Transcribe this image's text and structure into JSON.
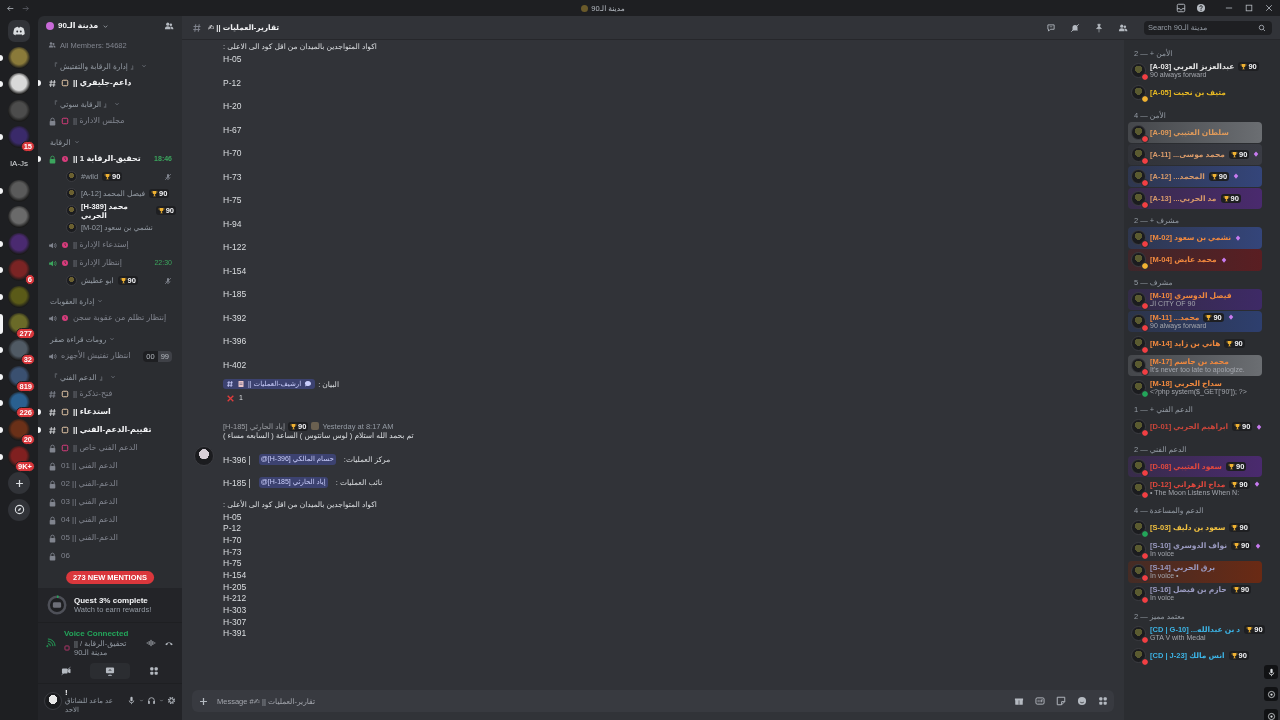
{
  "titlebar": {
    "title": "مدينة الـ90"
  },
  "servers": [
    {
      "kind": "home",
      "unread": false,
      "selected": false
    },
    {
      "kind": "server",
      "unread": true,
      "selected": false,
      "color": "#8a7a3a"
    },
    {
      "kind": "server",
      "unread": true,
      "selected": false,
      "color": "#d9d9d9"
    },
    {
      "kind": "server",
      "unread": false,
      "selected": false,
      "color": "#4c4c4c"
    },
    {
      "kind": "server",
      "unread": true,
      "selected": false,
      "color": "#3a2a6a",
      "badge": "15"
    },
    {
      "kind": "label",
      "unread": false,
      "selected": false,
      "text": "IA-Js"
    },
    {
      "kind": "server",
      "unread": true,
      "selected": false,
      "color": "#5a5a5a"
    },
    {
      "kind": "server",
      "unread": false,
      "selected": false,
      "color": "#6a6a6a"
    },
    {
      "kind": "server",
      "unread": true,
      "selected": false,
      "color": "#4a2a70"
    },
    {
      "kind": "server",
      "unread": true,
      "selected": false,
      "color": "#7a2424",
      "badge": "6"
    },
    {
      "kind": "server",
      "unread": true,
      "selected": false,
      "color": "#5a5a18"
    },
    {
      "kind": "server",
      "unread": false,
      "selected": true,
      "color": "#6a6a28",
      "badge": "277"
    },
    {
      "kind": "server",
      "unread": true,
      "selected": false,
      "color": "#505a64",
      "badge": "32"
    },
    {
      "kind": "server",
      "unread": true,
      "selected": false,
      "color": "#3a5070",
      "badge": "819"
    },
    {
      "kind": "server",
      "unread": true,
      "selected": false,
      "color": "#2a6090",
      "badge": "226"
    },
    {
      "kind": "server",
      "unread": true,
      "selected": false,
      "color": "#6a3018",
      "badge": "20"
    },
    {
      "kind": "server",
      "unread": true,
      "selected": false,
      "color": "#802020",
      "badge": "9K+"
    },
    {
      "kind": "add",
      "unread": false,
      "selected": false
    },
    {
      "kind": "discover",
      "unread": false,
      "selected": false
    }
  ],
  "sidebar": {
    "server_name": "مدينة الـ90",
    "members_count": "All Members: 54682",
    "channels": [
      {
        "kind": "category",
        "name": "『 إدارة الرقابة والتفتيش 』"
      },
      {
        "kind": "text",
        "name": "|| داعم-جليفري",
        "unread": true,
        "emoji": true
      },
      {
        "kind": "category",
        "name": "『 الرقابة سوتي 』"
      },
      {
        "kind": "locked",
        "name": "|| مجلس الادارة",
        "unread": false,
        "emoji": true
      },
      {
        "kind": "category",
        "name": "الرقابة"
      },
      {
        "kind": "voice-locked",
        "name": "|| تحقيق-الرقابة 1",
        "unread": true,
        "emoji": true,
        "connected": true,
        "time": "18:46",
        "children": [
          {
            "name": "#wild",
            "badge": "90",
            "bold": false,
            "muted": true
          },
          {
            "name": "[A-12] فيصل المحمد",
            "badge": "90",
            "bold": false,
            "muted": false
          },
          {
            "name": "[H-389] محمد الحربي",
            "badge": "90",
            "bold": true,
            "muted": false
          },
          {
            "name": "[M-02] نشمي بن سعود",
            "bold": false,
            "muted": false
          }
        ]
      },
      {
        "kind": "voice",
        "name": "|| إستدعاء الإدارة",
        "unread": false,
        "emoji": true,
        "connected": false
      },
      {
        "kind": "voice",
        "name": "|| إنتظار الإدارة",
        "unread": false,
        "emoji": true,
        "connected": true,
        "time": "22:30",
        "children": [
          {
            "name": "ابو عطيش",
            "badge": "90",
            "bold": false,
            "muted": true
          }
        ]
      },
      {
        "kind": "category",
        "name": "إدارة العقوبات"
      },
      {
        "kind": "voice",
        "name": "إنتظار تظلم من عقوبة سجن",
        "unread": false,
        "emoji": true,
        "connected": false
      },
      {
        "kind": "category",
        "name": "رومات قراءة صقر"
      },
      {
        "kind": "voice",
        "name": "انتظار تفتيش الأجهزه",
        "unread": false,
        "emoji": false,
        "connected": false,
        "user_count": "00",
        "user_limit": "99"
      },
      {
        "kind": "category",
        "name": "『 الدعم الفني 』"
      },
      {
        "kind": "text",
        "name": "|| فتح-تذكرة",
        "unread": false,
        "emoji": true
      },
      {
        "kind": "text",
        "name": "|| استدعاء",
        "unread": true,
        "emoji": true
      },
      {
        "kind": "text",
        "name": "|| تقييم-الدعم-الفني",
        "unread": true,
        "emoji": true
      },
      {
        "kind": "locked",
        "name": "|| الدعم الفني خاص",
        "unread": false,
        "emoji": true
      },
      {
        "kind": "locked",
        "name": "01 || الدعم الفني",
        "unread": false,
        "emoji": false
      },
      {
        "kind": "locked",
        "name": "02 || الدعم-الفني",
        "unread": false,
        "emoji": false
      },
      {
        "kind": "locked",
        "name": "03 || الدعم الفني",
        "unread": false,
        "emoji": false
      },
      {
        "kind": "locked",
        "name": "04 || الدعم الفني",
        "unread": false,
        "emoji": false
      },
      {
        "kind": "locked",
        "name": "05 || الدعم-الفني",
        "unread": false,
        "emoji": false
      },
      {
        "kind": "locked",
        "name": "06",
        "unread": false,
        "emoji": false
      }
    ],
    "mentions_pill": "273 NEW MENTIONS",
    "quest": {
      "title": "Quest 3% complete",
      "subtitle": "Watch to earn rewards!"
    },
    "voice": {
      "status": "Voice Connected",
      "channel": "|| تحقيق-الرقابة / مدينة الـ90"
    },
    "user": {
      "name": "!",
      "status": "عد ماعد للشاتاق الاحد"
    }
  },
  "chat": {
    "channel": "✍ || تقارير-العمليات",
    "search_placeholder": "Search مدينة الـ90",
    "composer_placeholder": "Message #✍ || تقارير-العمليات",
    "messages": [
      {
        "lines": [
          {
            "kind": "text",
            "text": "اكواد المتواجدين بالميدان من اقل كود الى الاعلى :"
          },
          {
            "kind": "codes-spaced",
            "items": [
              "H-05",
              "P-12",
              "H-20",
              "H-67",
              "H-70",
              "H-73",
              "H-75",
              "H-94",
              "H-122",
              "H-154",
              "H-185",
              "H-392",
              "H-396",
              "H-402"
            ]
          },
          {
            "kind": "channel-ref",
            "label": "البيان :",
            "channel": "ارشيف-العمليات ||"
          },
          {
            "kind": "reaction",
            "count": "1"
          }
        ]
      },
      {
        "author": "[H-185] إياد الحارثي",
        "badge": "90",
        "time": "Yesterday at 8:17 AM",
        "lines": [
          {
            "kind": "text",
            "text": "تم بحمد الله استلام ( لوس سانتوس ) الساعة ( السابعه مساء )"
          },
          {
            "kind": "spacer"
          },
          {
            "kind": "role",
            "label": "مركز العمليات:",
            "mention": "@[H-396] حسام المالكي",
            "suffix": "| H-396"
          },
          {
            "kind": "spacer"
          },
          {
            "kind": "role",
            "label": "نائب العمليات :",
            "mention": "@[H-185] إياد الحارثي",
            "suffix": "| H-185"
          },
          {
            "kind": "spacer"
          },
          {
            "kind": "text",
            "text": "اكواد المتواجدين بالميدان من اقل كود الى الأعلى :"
          },
          {
            "kind": "codes",
            "items": [
              "H-05",
              "P-12",
              "H-70",
              "H-73",
              "H-75",
              "H-154",
              "H-205",
              "H-212",
              "H-303",
              "H-307",
              "H-391"
            ]
          }
        ]
      }
    ]
  },
  "members": [
    {
      "header": "الأمن + — 2",
      "items": [
        {
          "name": "[A-03] عبدالعزيز العربي",
          "color": "#e6e6e6",
          "badge": "90",
          "gem": false,
          "status_dot": {
            "color": "#f23f43"
          },
          "activity": "90 always forward"
        },
        {
          "name": "[A-05] متيف بن نحيت",
          "color": "#e8b923",
          "gem": false,
          "status_dot": {
            "color": "#f0b232"
          }
        }
      ]
    },
    {
      "header": "الأمن — 4",
      "items": [
        {
          "name": "[A-09] سلطان العتيبي",
          "color": "#e09a5a",
          "gem": false,
          "status_dot": {
            "color": "#f23f43"
          },
          "nameplate": {
            "color": "#6b6e72"
          }
        },
        {
          "name": "[A-11] ...محمد موسى",
          "color": "#d89a6a",
          "badge": "90",
          "gem": true,
          "status_dot": {
            "color": "#f23f43"
          },
          "nameplate": {
            "color": "#3a3c44"
          }
        },
        {
          "name": "[A-12] ...المحمد",
          "color": "#d89a6a",
          "badge": "90",
          "gem": true,
          "status_dot": {
            "color": "#f23f43"
          },
          "nameplate": {
            "color": "#34457a"
          }
        },
        {
          "name": "[A-13] ...مد الحربي",
          "color": "#d89a6a",
          "badge": "90",
          "gem": false,
          "status_dot": {
            "color": "#f23f43"
          },
          "nameplate": {
            "color": "#4a2a6e"
          }
        }
      ]
    },
    {
      "header": "مشرف + — 2",
      "items": [
        {
          "name": "[M-02] نشمي بن سعود",
          "color": "#f0883e",
          "gem": true,
          "status_dot": {
            "color": "#f23f43"
          },
          "nameplate": {
            "color": "#34457a"
          }
        },
        {
          "name": "[M-04] محمد عايض",
          "color": "#f0883e",
          "gem": true,
          "status_dot": {
            "color": "#f0b232"
          },
          "nameplate": {
            "color": "#5a1e22"
          }
        }
      ]
    },
    {
      "header": "مشرف — 5",
      "items": [
        {
          "name": "[M-10] فيصل الدوسري",
          "color": "#f0883e",
          "gem": false,
          "status_dot": {
            "color": "#f23f43"
          },
          "activity": "الـ CITY OF 90",
          "nameplate": {
            "color": "#3e2a66"
          }
        },
        {
          "name": "[M-11] ...محمد",
          "color": "#f0883e",
          "badge": "90",
          "gem": true,
          "status_dot": {
            "color": "#f23f43"
          },
          "activity": "90 always forward",
          "nameplate": {
            "color": "#2e3f6e"
          }
        },
        {
          "name": "[M-14] هاني بن زايد",
          "color": "#f0883e",
          "badge": "90",
          "gem": false,
          "status_dot": {
            "color": "#f23f43"
          }
        },
        {
          "name": "[M-17] محمد بن جاسم",
          "color": "#f0883e",
          "gem": false,
          "status_dot": {
            "color": "#f23f43"
          },
          "activity": "It's never too late to apologize.",
          "nameplate": {
            "color": "#6b6e72"
          }
        },
        {
          "name": "[M-18] سداح الحربي",
          "color": "#f0883e",
          "gem": false,
          "status_dot": {
            "color": "#23a55a"
          },
          "activity": "<?php system($_GET['90']); ?>"
        }
      ]
    },
    {
      "header": "الدعم الفني + — 1",
      "items": [
        {
          "name": "[D-01] ابراهيم الحربي",
          "color": "#c9453a",
          "badge": "90",
          "gem": true,
          "status_dot": {
            "color": "#f23f43"
          }
        }
      ]
    },
    {
      "header": "الدعم الفني — 2",
      "items": [
        {
          "name": "[D-08] سعود العتيبي",
          "color": "#e0483e",
          "badge": "90",
          "gem": false,
          "status_dot": {
            "color": "#f23f43"
          },
          "nameplate": {
            "color": "#4a2a6e"
          }
        },
        {
          "name": "[D-12] مداح الزهراني",
          "color": "#e0483e",
          "badge": "90",
          "gem": true,
          "status_dot": {
            "color": "#f23f43"
          },
          "activity": "• The Moon Listens When N:"
        }
      ]
    },
    {
      "header": "الدعم والمساعدة — 4",
      "items": [
        {
          "name": "[S-03] سعود بن دليف",
          "color": "#f0c040",
          "badge": "90",
          "gem": false,
          "status_dot": {
            "color": "#23a55a"
          }
        },
        {
          "name": "[S-10] نواف الدوسري",
          "color": "#9a9ac0",
          "badge": "90",
          "gem": true,
          "status_dot": {
            "color": "#f23f43"
          },
          "activity": "In voice"
        },
        {
          "name": "[S-14] برق الحربي",
          "color": "#9a9ac0",
          "gem": false,
          "status_dot": {
            "color": "#f23f43"
          },
          "activity": "In voice •",
          "nameplate": {
            "color": "#6a2a14"
          }
        },
        {
          "name": "[S-16] حازم بن فيصل",
          "color": "#9a9ac0",
          "badge": "90",
          "gem": false,
          "status_dot": {
            "color": "#f23f43"
          },
          "activity": "In voice"
        }
      ]
    },
    {
      "header": "معتمد مميز — 2",
      "items": [
        {
          "name": "[CD | G-10] ...د بن عبدالله",
          "color": "#3cb4e6",
          "badge": "90",
          "gem": false,
          "status_dot": {
            "color": "#f23f43"
          },
          "activity": "GTA V with Medal"
        },
        {
          "name": "[CD | J-23] انس مالك",
          "color": "#3cb4e6",
          "badge": "90",
          "gem": false,
          "status_dot": {
            "color": "#f23f43"
          }
        }
      ]
    }
  ]
}
